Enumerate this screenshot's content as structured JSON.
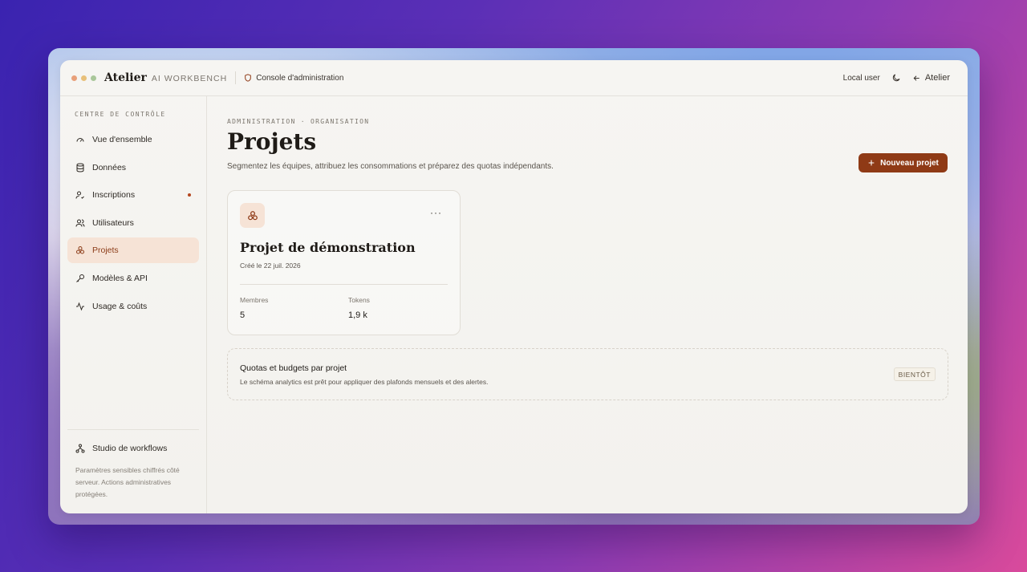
{
  "header": {
    "brand": "Atelier",
    "brand_sub": "AI WORKBENCH",
    "console_label": "Console d'administration",
    "user_label": "Local user",
    "back_label": "Atelier",
    "dot_colors": [
      "#e8a07a",
      "#e8c07a",
      "#a9c79a"
    ]
  },
  "sidebar": {
    "heading": "CENTRE DE CONTRÔLE",
    "items": [
      {
        "label": "Vue d'ensemble",
        "icon": "gauge-icon"
      },
      {
        "label": "Données",
        "icon": "database-icon"
      },
      {
        "label": "Inscriptions",
        "icon": "user-check-icon",
        "notification": true
      },
      {
        "label": "Utilisateurs",
        "icon": "users-icon"
      },
      {
        "label": "Projets",
        "icon": "boxes-icon",
        "active": true
      },
      {
        "label": "Modèles & API",
        "icon": "key-icon"
      },
      {
        "label": "Usage & coûts",
        "icon": "activity-icon"
      }
    ],
    "studio_label": "Studio de workflows",
    "note": "Paramètres sensibles chiffrés côté serveur. Actions administratives protégées."
  },
  "main": {
    "eyebrow": "ADMINISTRATION · ORGANISATION",
    "title": "Projets",
    "subtitle": "Segmentez les équipes, attribuez les consommations et préparez des quotas indépendants.",
    "new_button": "Nouveau projet",
    "project_card": {
      "name": "Projet de démonstration",
      "created": "Créé le 22 juil. 2026",
      "members_label": "Membres",
      "members_value": "5",
      "tokens_label": "Tokens",
      "tokens_value": "1,9 k"
    },
    "quota": {
      "title": "Quotas et budgets par projet",
      "description": "Le schéma analytics est prêt pour appliquer des plafonds mensuels et des alertes.",
      "badge": "BIENTÔT"
    }
  },
  "colors": {
    "accent": "#8f3a16",
    "active_bg": "#f6e3d6",
    "notification": "#b4461e"
  }
}
